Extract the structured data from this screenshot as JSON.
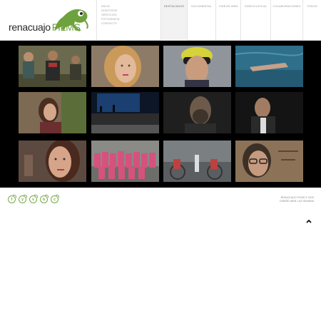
{
  "brand": {
    "name": "renacuajo",
    "suffix": "FILMS",
    "accent": "#6ea23d"
  },
  "smallnav": [
    "INICIO",
    "NOSOTROS",
    "SERVICIOS",
    "FOTOGRAFIA",
    "CONTACTO"
  ],
  "tabs": [
    {
      "label": "DESTACADOS",
      "active": true
    },
    {
      "label": "DOCUMENTAL",
      "active": false
    },
    {
      "label": "VIDEOS WEB",
      "active": false
    },
    {
      "label": "VIDEOCLIP/CAL",
      "active": false
    },
    {
      "label": "COLABORACIONES",
      "active": false
    },
    {
      "label": "TODOS",
      "active": false
    }
  ],
  "gallery": {
    "background": "#000000",
    "items": [
      {
        "subject": "group-of-people-outdoors"
      },
      {
        "subject": "blonde-woman-closeup"
      },
      {
        "subject": "cyclist-with-sunglasses"
      },
      {
        "subject": "swimmer-underwater"
      },
      {
        "subject": "woman-in-field"
      },
      {
        "subject": "dark-stage"
      },
      {
        "subject": "man-closeup-dark"
      },
      {
        "subject": "man-speaking"
      },
      {
        "subject": "woman-face-closeup"
      },
      {
        "subject": "pink-team-group"
      },
      {
        "subject": "wheelchair-athletes"
      },
      {
        "subject": "man-with-glasses"
      }
    ]
  },
  "scroll_top": {
    "icon": "chevron-up-icon"
  },
  "social_icons": [
    "f",
    "y",
    "v",
    "b",
    "c"
  ],
  "footer": {
    "line1": "RENACUAJO FILMS © 2015",
    "line2": "DISEÑO WEB: LAS SEMANA"
  }
}
